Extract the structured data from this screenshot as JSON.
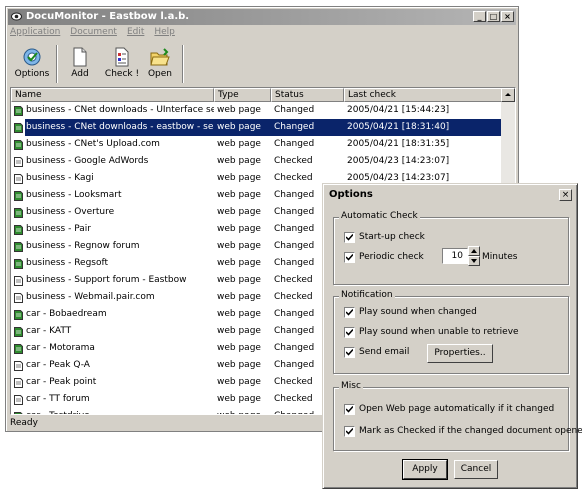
{
  "window": {
    "title": "DocuMonitor - Eastbow l.a.b.",
    "controls": {
      "minimize": "_",
      "maximize": "□",
      "close": "×"
    }
  },
  "menu": [
    "Application",
    "Document",
    "Edit",
    "Help"
  ],
  "toolbar": [
    {
      "label": "Options",
      "icon": "options-icon"
    },
    {
      "label": "Add",
      "icon": "add-document-icon"
    },
    {
      "label": "Check !",
      "icon": "check-document-icon"
    },
    {
      "label": "Open",
      "icon": "open-folder-icon"
    }
  ],
  "list": {
    "columns": [
      "Name",
      "Type",
      "Status",
      "Last check"
    ],
    "rows": [
      {
        "name": "business - CNet downloads - UInterface sea...",
        "type": "web page",
        "status": "Changed",
        "last": "2005/04/21 [15:44:23]",
        "icon": "changed"
      },
      {
        "name": "business - CNet downloads - eastbow - search",
        "type": "web page",
        "status": "Changed",
        "last": "2005/04/21 [18:31:40]",
        "icon": "changed",
        "selected": true
      },
      {
        "name": "business - CNet's Upload.com",
        "type": "web page",
        "status": "Changed",
        "last": "2005/04/21 [18:31:35]",
        "icon": "changed"
      },
      {
        "name": "business - Google AdWords",
        "type": "web page",
        "status": "Checked",
        "last": "2005/04/23 [14:23:07]",
        "icon": "checked"
      },
      {
        "name": "business - Kagi",
        "type": "web page",
        "status": "Checked",
        "last": "2005/04/23 [14:23:07]",
        "icon": "checked"
      },
      {
        "name": "business - Looksmart",
        "type": "web page",
        "status": "Changed",
        "last": "",
        "icon": "changed"
      },
      {
        "name": "business - Overture",
        "type": "web page",
        "status": "Changed",
        "last": "",
        "icon": "changed"
      },
      {
        "name": "business - Pair",
        "type": "web page",
        "status": "Changed",
        "last": "",
        "icon": "changed"
      },
      {
        "name": "business - Regnow forum",
        "type": "web page",
        "status": "Changed",
        "last": "",
        "icon": "changed"
      },
      {
        "name": "business - Regsoft",
        "type": "web page",
        "status": "Changed",
        "last": "",
        "icon": "changed"
      },
      {
        "name": "business - Support forum - Eastbow",
        "type": "web page",
        "status": "Checked",
        "last": "",
        "icon": "checked"
      },
      {
        "name": "business - Webmail.pair.com",
        "type": "web page",
        "status": "Checked",
        "last": "",
        "icon": "checked"
      },
      {
        "name": "car - Bobaedream",
        "type": "web page",
        "status": "Changed",
        "last": "",
        "icon": "changed"
      },
      {
        "name": "car - KATT",
        "type": "web page",
        "status": "Changed",
        "last": "",
        "icon": "changed"
      },
      {
        "name": "car - Motorama",
        "type": "web page",
        "status": "Changed",
        "last": "",
        "icon": "changed"
      },
      {
        "name": "car - Peak Q-A",
        "type": "web page",
        "status": "Changed",
        "last": "",
        "icon": "checked"
      },
      {
        "name": "car - Peak point",
        "type": "web page",
        "status": "Checked",
        "last": "",
        "icon": "checked"
      },
      {
        "name": "car - TT forum",
        "type": "web page",
        "status": "Checked",
        "last": "",
        "icon": "checked"
      },
      {
        "name": "car - Testdrive",
        "type": "web page",
        "status": "Changed",
        "last": "",
        "icon": "changed"
      }
    ]
  },
  "statusbar": "Ready",
  "options": {
    "title": "Options",
    "close": "×",
    "auto": {
      "legend": "Automatic Check",
      "startup": "Start-up check",
      "periodic": "Periodic check",
      "interval": "10",
      "unit": "Minutes"
    },
    "notify": {
      "legend": "Notification",
      "sound_changed": "Play sound when changed",
      "sound_unable": "Play sound when unable to retrieve",
      "email": "Send email",
      "properties": "Properties.."
    },
    "misc": {
      "legend": "Misc",
      "open_web": "Open Web page automatically if it changed",
      "mark_checked": "Mark as Checked if the changed document opened"
    },
    "apply": "Apply",
    "cancel": "Cancel"
  },
  "colors": {
    "selection": "#0a246a",
    "face": "#d4d0c8",
    "changed_icon": "#2e8b2e"
  }
}
